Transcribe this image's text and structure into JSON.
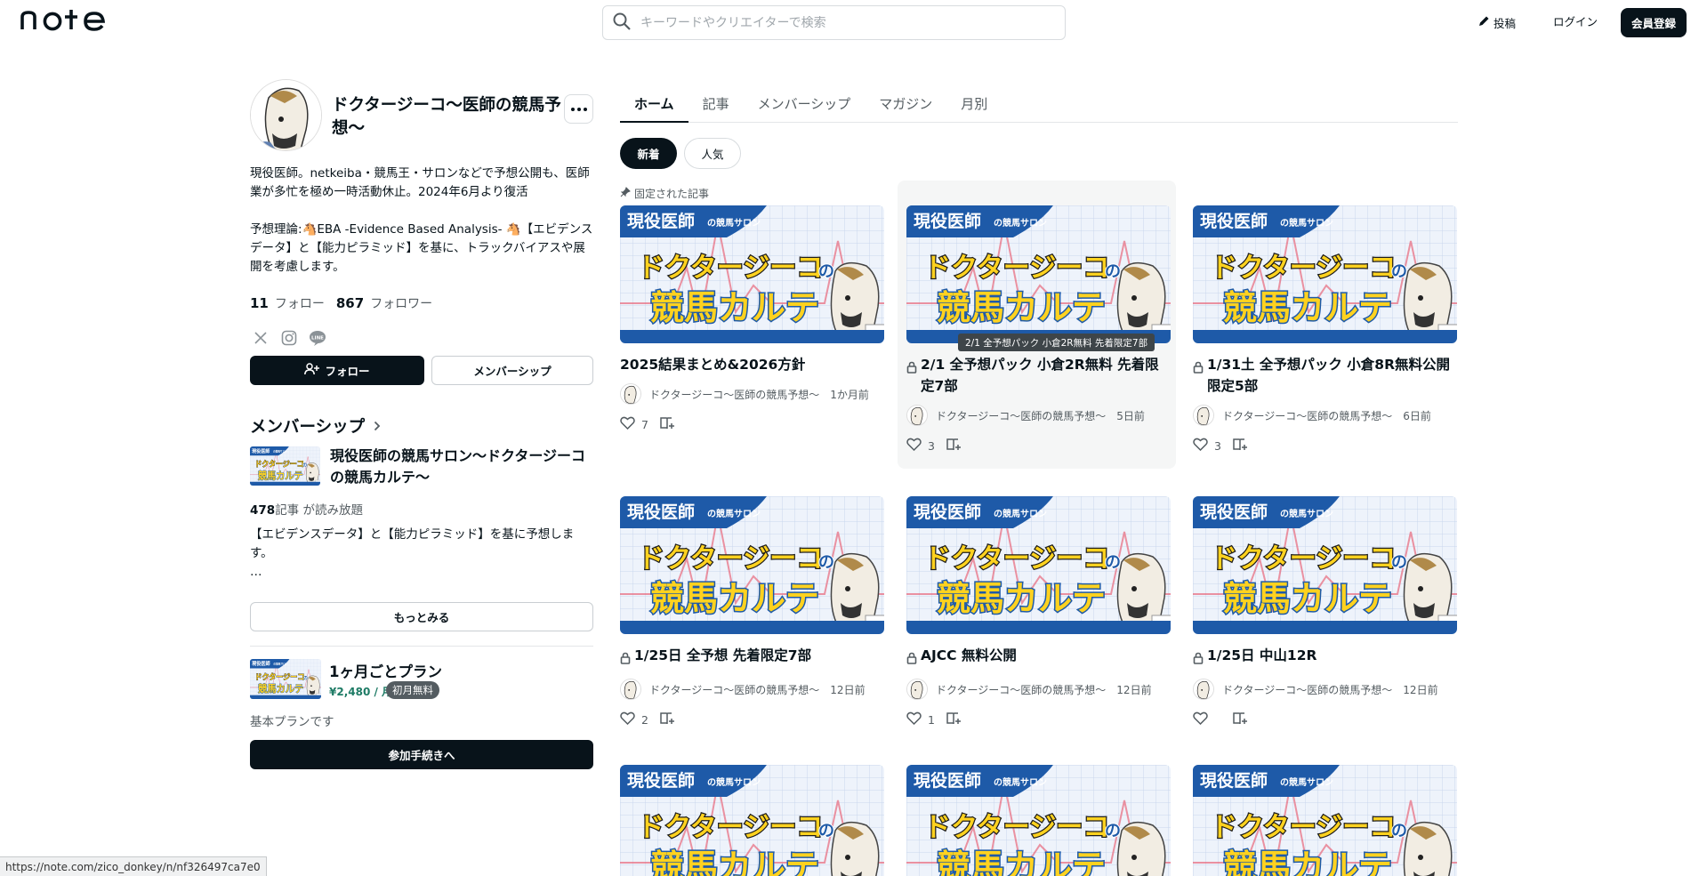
{
  "header": {
    "logo": "note",
    "search_placeholder": "キーワードやクリエイターで検索",
    "post_label": "投稿",
    "login_label": "ログイン",
    "signup_label": "会員登録"
  },
  "profile": {
    "name": "ドクタージーコ〜医師の競馬予想〜",
    "bio": [
      "現役医師。netkeiba・競馬王・サロンなどで予想公開も、医師業が多忙を極め一時活動休止。2024年6月より復活",
      "予想理論:🐴EBA -Evidence Based Analysis- 🐴【エビデンスデータ】と【能力ピラミッド】を基に、トラックバイアスや展開を考慮します。"
    ],
    "follow_count": "11",
    "follow_label": "フォロー",
    "follower_count": "867",
    "follower_label": "フォロワー",
    "social_icons": [
      "x-icon",
      "instagram-icon",
      "line-icon"
    ],
    "follow_button": "フォロー",
    "membership_button": "メンバーシップ"
  },
  "membership": {
    "heading": "メンバーシップ",
    "title": "現役医師の競馬サロン〜ドクタージーコの競馬カルテ〜",
    "article_count": "478",
    "article_count_suffix": "記事 が読み放題",
    "description": "【エビデンスデータ】と【能力ピラミッド】を基に予想します。",
    "ellipsis": "…",
    "more_button": "もっとみる",
    "plan": {
      "name": "1ヶ月ごとプラン",
      "price": "¥2,480 / 月",
      "badge": "初月無料",
      "basic": "基本プランです",
      "join_button": "参加手続きへ"
    }
  },
  "tabs": [
    "ホーム",
    "記事",
    "メンバーシップ",
    "マガジン",
    "月別"
  ],
  "filters": {
    "new": "新着",
    "popular": "人気"
  },
  "pinned_label": "固定された記事",
  "thumb_text": {
    "top": "現役医師",
    "top_small": "の競馬サロン",
    "mid": "ドクタージーコ",
    "mid_small": "の",
    "bottom": "競馬カルテ"
  },
  "tooltip": "2/1 全予想パック 小倉2R無料 先着限定7部",
  "cards": [
    {
      "title": "2025結果まとめ&2026方針",
      "locked": false,
      "author": "ドクタージーコ〜医師の競馬予想〜",
      "date": "1か月前",
      "likes": "7"
    },
    {
      "title": "2/1 全予想パック 小倉2R無料 先着限定7部",
      "locked": true,
      "author": "ドクタージーコ〜医師の競馬予想〜",
      "date": "5日前",
      "likes": "3"
    },
    {
      "title": "1/31土 全予想パック 小倉8R無料公開 限定5部",
      "locked": true,
      "author": "ドクタージーコ〜医師の競馬予想〜",
      "date": "6日前",
      "likes": "3"
    },
    {
      "title": "1/25日 全予想 先着限定7部",
      "locked": true,
      "author": "ドクタージーコ〜医師の競馬予想〜",
      "date": "12日前",
      "likes": "2"
    },
    {
      "title": "AJCC 無料公開",
      "locked": true,
      "author": "ドクタージーコ〜医師の競馬予想〜",
      "date": "12日前",
      "likes": "1"
    },
    {
      "title": "1/25日 中山12R",
      "locked": true,
      "author": "ドクタージーコ〜医師の競馬予想〜",
      "date": "12日前",
      "likes": ""
    }
  ],
  "status_url": "https://note.com/zico_donkey/n/nf326497ca7e0",
  "colors": {
    "primary": "#08131a",
    "price_green": "#1e7b65",
    "thumb_blue": "#1e5aa8",
    "thumb_yellow": "#ffd21f"
  }
}
